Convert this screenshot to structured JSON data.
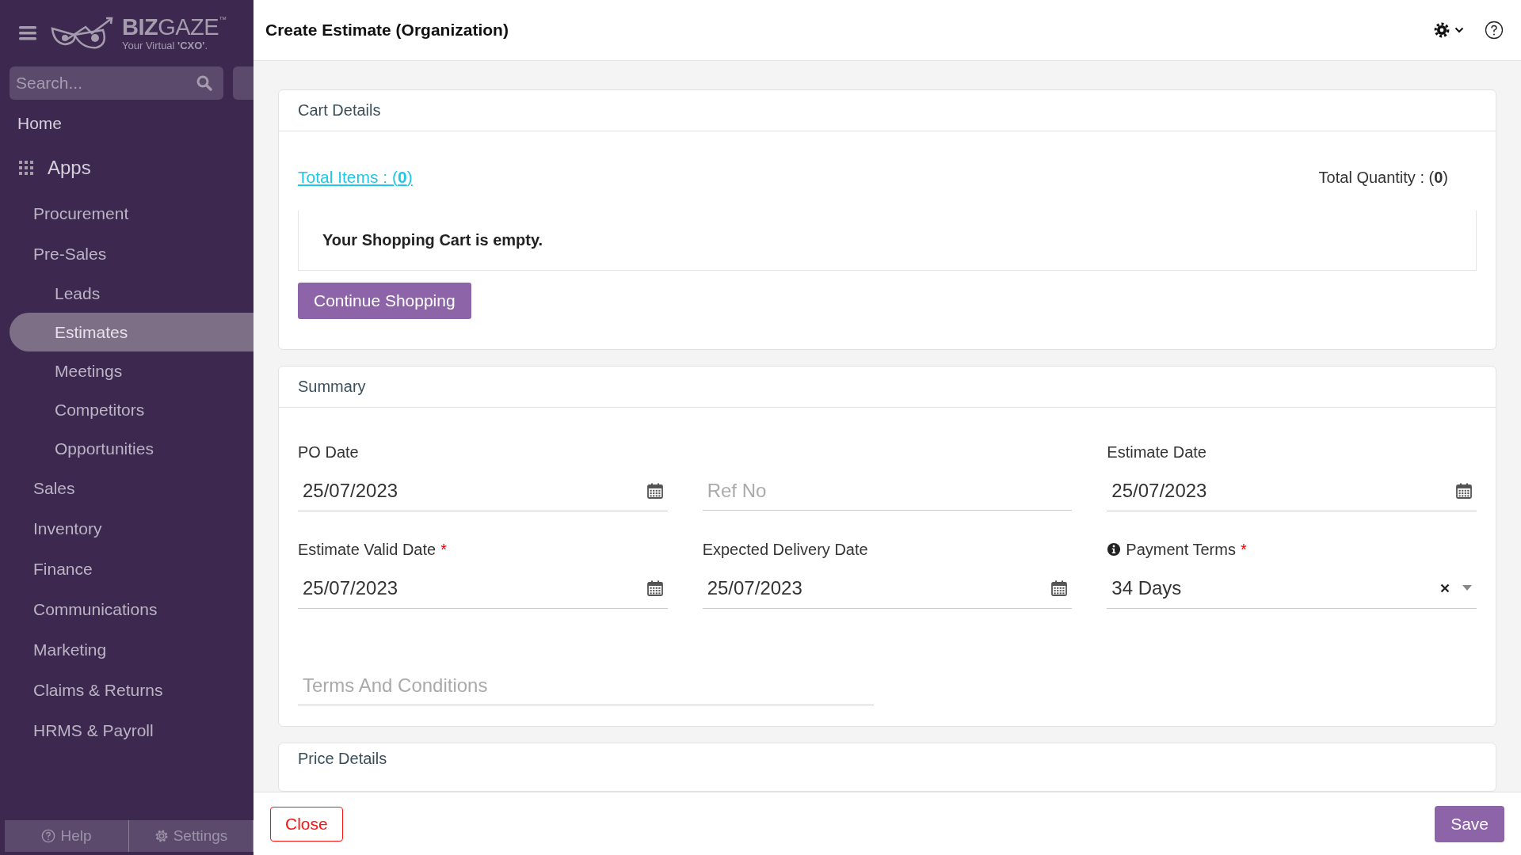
{
  "sidebar": {
    "logo": {
      "brand_bold": "BIZ",
      "brand": "GAZE",
      "trademark": "™",
      "tagline": "Your Virtual **'CXO'**."
    },
    "search": {
      "placeholder": "Search..."
    },
    "nav": [
      {
        "label": "Home",
        "kind": "top",
        "selected": false
      },
      {
        "label": "Apps",
        "kind": "section",
        "selected": false
      },
      {
        "label": "Procurement",
        "kind": "group",
        "selected": false
      },
      {
        "label": "Pre-Sales",
        "kind": "group",
        "selected": false,
        "children": [
          {
            "label": "Leads",
            "selected": false
          },
          {
            "label": "Estimates",
            "selected": true
          },
          {
            "label": "Meetings",
            "selected": false
          },
          {
            "label": "Competitors",
            "selected": false
          },
          {
            "label": "Opportunities",
            "selected": false
          }
        ]
      },
      {
        "label": "Sales",
        "kind": "group",
        "selected": false
      },
      {
        "label": "Inventory",
        "kind": "group",
        "selected": false
      },
      {
        "label": "Finance",
        "kind": "group",
        "selected": false
      },
      {
        "label": "Communications",
        "kind": "group",
        "selected": false
      },
      {
        "label": "Marketing",
        "kind": "group",
        "selected": false
      },
      {
        "label": "Claims & Returns",
        "kind": "group",
        "selected": false
      },
      {
        "label": "HRMS & Payroll",
        "kind": "group",
        "selected": false
      }
    ],
    "footer": [
      {
        "label": "Help",
        "kind": "help"
      },
      {
        "label": "Settings",
        "kind": "settings"
      }
    ]
  },
  "header": {
    "title": "Create Estimate (Organization)"
  },
  "cart": {
    "title": "Cart Details",
    "total_items": "Total Items : (**0**)",
    "total_quantity": "Total Quantity : (**0**)",
    "empty_message": "Your Shopping Cart is empty.",
    "button": "Continue Shopping"
  },
  "summary": {
    "title": "Summary",
    "fields": [
      {
        "kind": "date",
        "label": "PO Date",
        "value": "25/07/2023"
      },
      {
        "kind": "text",
        "placeholder": "Ref No"
      },
      {
        "kind": "date",
        "label": "Estimate Date",
        "value": "25/07/2023"
      },
      {
        "kind": "date",
        "label": "Estimate Valid Date",
        "value": "25/07/2023",
        "required_mark": "*"
      },
      {
        "kind": "date",
        "label": "Expected Delivery Date",
        "value": "25/07/2023"
      },
      {
        "kind": "select",
        "label": "Payment Terms",
        "value": "34 Days",
        "required_mark": "*",
        "info": true
      },
      {
        "kind": "textarea",
        "placeholder": "Terms And Conditions"
      }
    ]
  },
  "next_section": {
    "title": "Price Details"
  },
  "footer": {
    "close": "Close",
    "save": "Save"
  }
}
